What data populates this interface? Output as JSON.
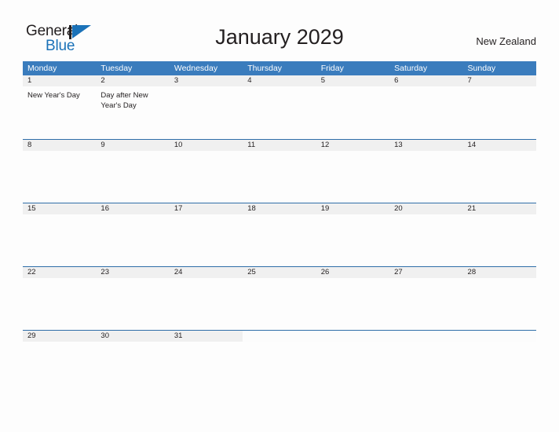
{
  "brand": {
    "name_part1": "General",
    "name_part2": "Blue",
    "mark": "triangle-flag"
  },
  "header": {
    "title": "January 2029",
    "country": "New Zealand"
  },
  "colors": {
    "header_blue": "#3a7cbd",
    "accent_blue": "#1b72b8",
    "row_line": "#2f6ea8",
    "day_band": "#f0f0f0",
    "text": "#231f20",
    "page_background": "#fdfdfd"
  },
  "calendar": {
    "weekdays": [
      "Monday",
      "Tuesday",
      "Wednesday",
      "Thursday",
      "Friday",
      "Saturday",
      "Sunday"
    ],
    "weeks": [
      [
        {
          "num": "1",
          "events": [
            "New Year's Day"
          ]
        },
        {
          "num": "2",
          "events": [
            "Day after New Year's Day"
          ]
        },
        {
          "num": "3",
          "events": []
        },
        {
          "num": "4",
          "events": []
        },
        {
          "num": "5",
          "events": []
        },
        {
          "num": "6",
          "events": []
        },
        {
          "num": "7",
          "events": []
        }
      ],
      [
        {
          "num": "8",
          "events": []
        },
        {
          "num": "9",
          "events": []
        },
        {
          "num": "10",
          "events": []
        },
        {
          "num": "11",
          "events": []
        },
        {
          "num": "12",
          "events": []
        },
        {
          "num": "13",
          "events": []
        },
        {
          "num": "14",
          "events": []
        }
      ],
      [
        {
          "num": "15",
          "events": []
        },
        {
          "num": "16",
          "events": []
        },
        {
          "num": "17",
          "events": []
        },
        {
          "num": "18",
          "events": []
        },
        {
          "num": "19",
          "events": []
        },
        {
          "num": "20",
          "events": []
        },
        {
          "num": "21",
          "events": []
        }
      ],
      [
        {
          "num": "22",
          "events": []
        },
        {
          "num": "23",
          "events": []
        },
        {
          "num": "24",
          "events": []
        },
        {
          "num": "25",
          "events": []
        },
        {
          "num": "26",
          "events": []
        },
        {
          "num": "27",
          "events": []
        },
        {
          "num": "28",
          "events": []
        }
      ],
      [
        {
          "num": "29",
          "events": []
        },
        {
          "num": "30",
          "events": []
        },
        {
          "num": "31",
          "events": []
        },
        {
          "num": "",
          "events": []
        },
        {
          "num": "",
          "events": []
        },
        {
          "num": "",
          "events": []
        },
        {
          "num": "",
          "events": []
        }
      ]
    ]
  }
}
